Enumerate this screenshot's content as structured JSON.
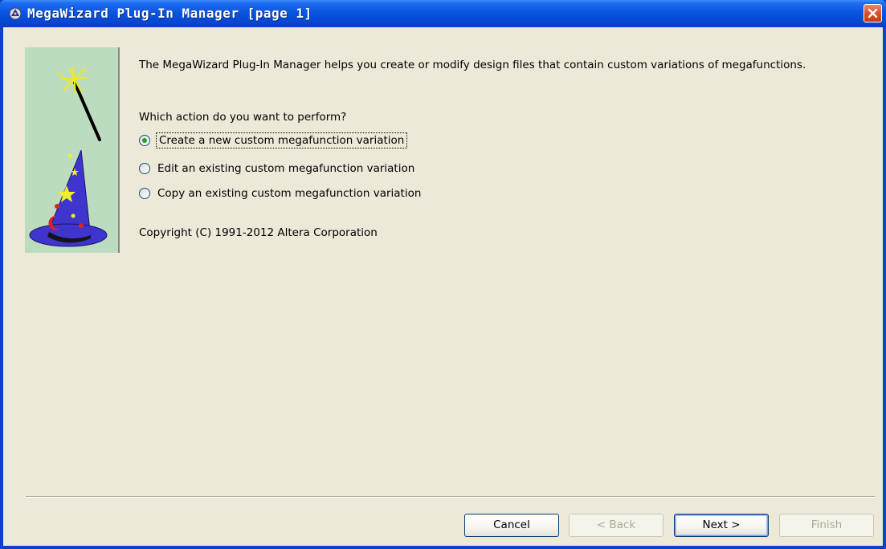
{
  "window": {
    "title": "MegaWizard Plug-In Manager [page 1]"
  },
  "content": {
    "intro": "The MegaWizard Plug-In Manager helps you create or modify design files that contain custom variations of megafunctions.",
    "question": "Which action do you want to perform?",
    "options": [
      {
        "label": "Create a new custom megafunction variation",
        "selected": true
      },
      {
        "label": "Edit an existing custom megafunction variation",
        "selected": false
      },
      {
        "label": "Copy an existing custom megafunction variation",
        "selected": false
      }
    ],
    "copyright": "Copyright (C) 1991-2012 Altera Corporation"
  },
  "buttons": {
    "cancel": "Cancel",
    "back": "< Back",
    "next": "Next >",
    "finish": "Finish"
  },
  "colors": {
    "titlebar": "#0a55e0",
    "client_bg": "#ece9d8",
    "art_bg": "#bcdcc0",
    "radio_dot": "#21a121"
  },
  "icons": [
    "wizard-app-icon",
    "close-icon",
    "wizard-hat-icon",
    "magic-wand-icon"
  ]
}
